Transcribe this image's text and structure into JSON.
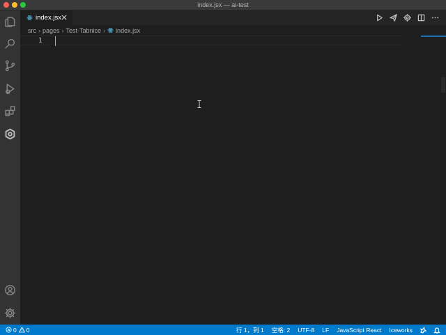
{
  "window": {
    "title": "index.jsx — ai-test"
  },
  "tabs": [
    {
      "label": "index.jsx",
      "active": true
    }
  ],
  "breadcrumb": {
    "items": [
      "src",
      "pages",
      "Test-Tabnice",
      "index.jsx"
    ]
  },
  "editor": {
    "line_numbers": [
      "1"
    ]
  },
  "statusbar": {
    "errors": "0",
    "warnings": "0",
    "position": "行 1，列 1",
    "indent": "空格: 2",
    "encoding": "UTF-8",
    "eol": "LF",
    "language": "JavaScript React",
    "extension": "Iceworks"
  },
  "colors": {
    "accent": "#007acc",
    "editor_bg": "#1e1e1e",
    "activity_bar": "#333333",
    "tab_bar": "#252526",
    "react_icon": "#519aba"
  },
  "icons": {
    "activity": [
      "explorer-icon",
      "search-icon",
      "source-control-icon",
      "run-debug-icon",
      "extensions-icon",
      "iceworks-icon",
      "account-icon",
      "settings-gear-icon"
    ],
    "editor_actions": [
      "run-icon",
      "send-icon",
      "gear-icon",
      "split-editor-icon",
      "more-icon"
    ]
  }
}
